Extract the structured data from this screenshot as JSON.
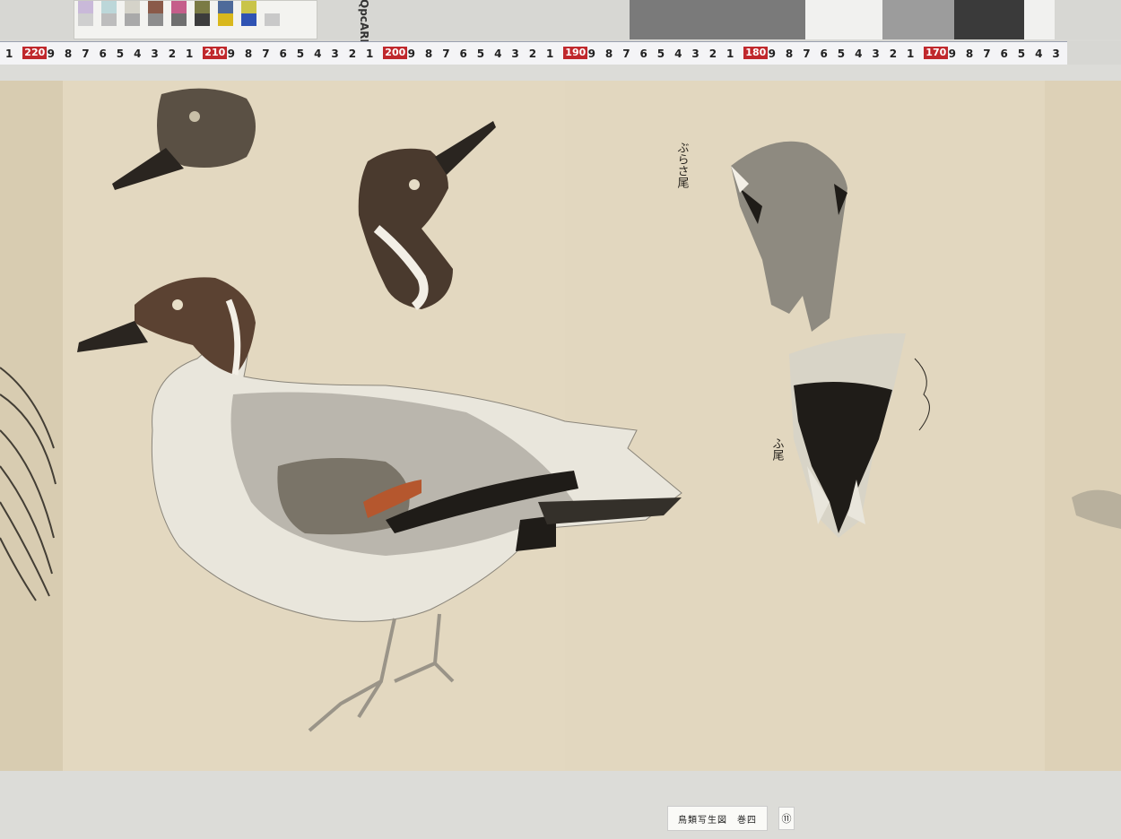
{
  "color_card": {
    "brand": "QpcARD",
    "swatches_row1": [
      "#c9b9d9",
      "#bcd7d9",
      "#d5d3c9",
      "#8a5a49",
      "#c55e8a",
      "#7a7a44",
      "#4e6a9a",
      "#c9c449"
    ],
    "swatches_row2": [
      "#cfcfcf",
      "#bdbdbd",
      "#a9a9a9",
      "#8d8d8d",
      "#6f6f6f",
      "#3c3c3c",
      "#d9b81c",
      "#2f53b3",
      "#c9c9c9"
    ]
  },
  "ruler": {
    "major_marks": [
      "220",
      "210",
      "200",
      "190",
      "180",
      "170"
    ],
    "minor_digits": [
      "9",
      "8",
      "7",
      "6",
      "5",
      "4",
      "3",
      "2",
      "1"
    ]
  },
  "caption": {
    "title": "鳥類写生図　巻四",
    "plate_number": "⑪"
  },
  "annotations": {
    "upper_note": "ぶらさ尾",
    "lower_note": "ふ尾"
  },
  "palette": {
    "paper": "#e0d5bd",
    "paper_dark": "#d4c6a8",
    "ink": "#1f1c18",
    "head_brown": "#5b4232",
    "rust": "#b5572e"
  }
}
